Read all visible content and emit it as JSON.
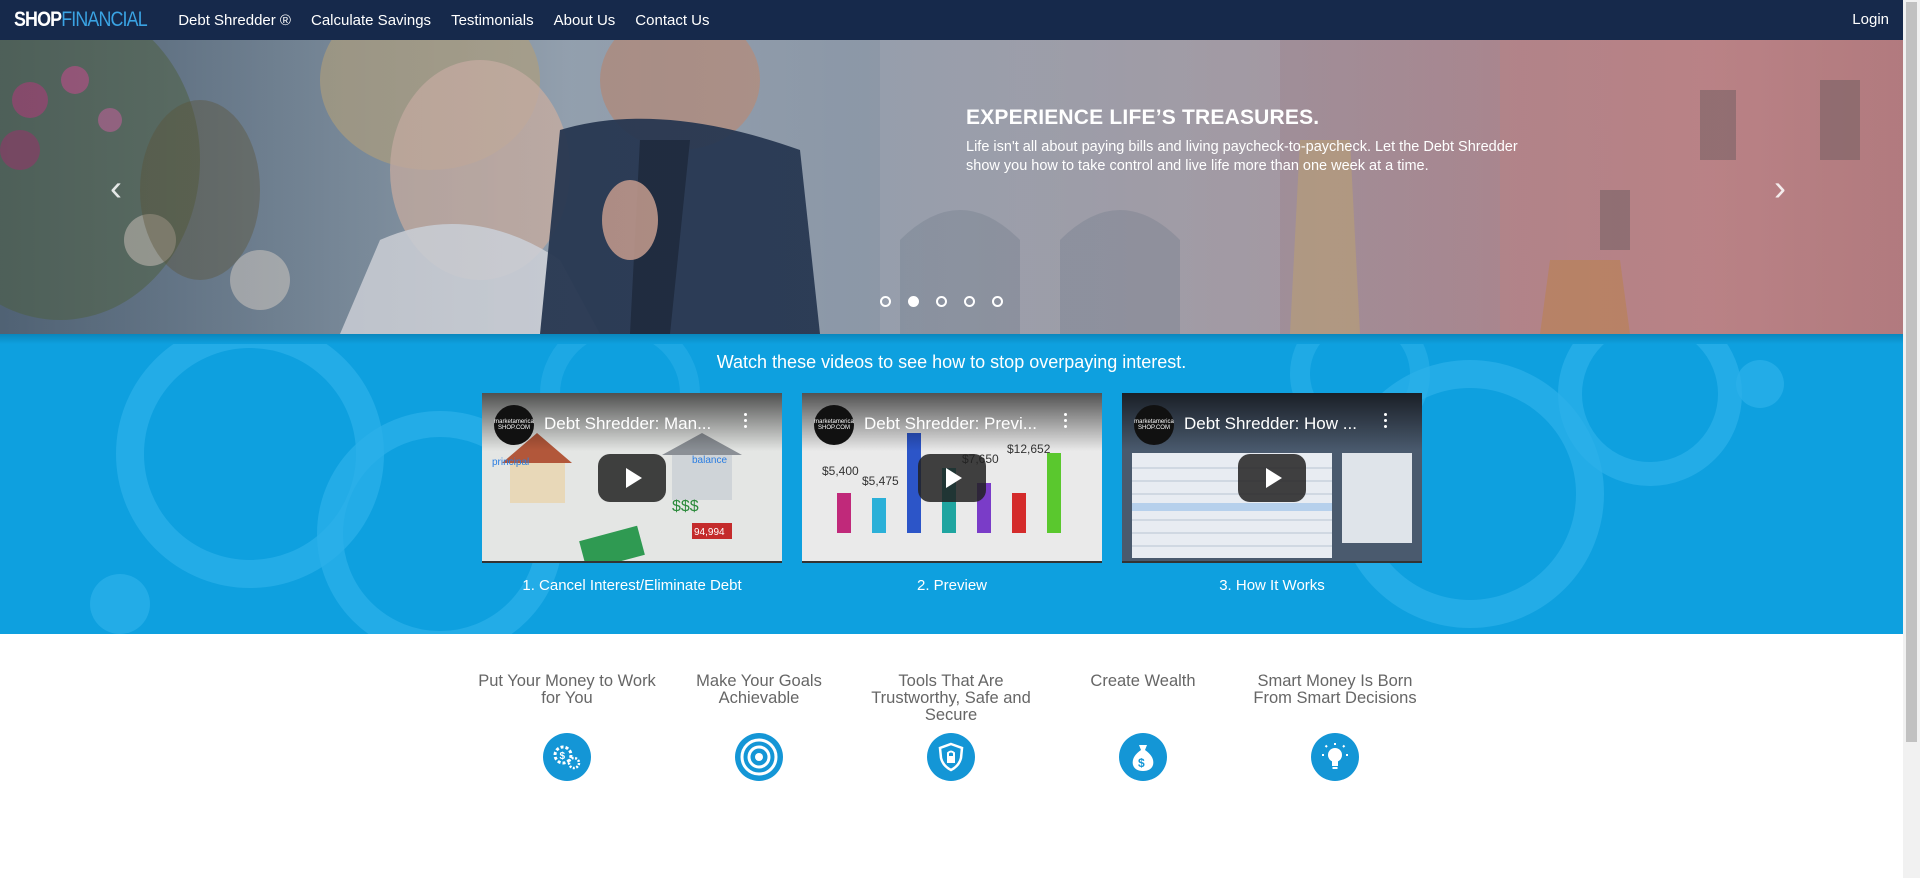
{
  "nav": {
    "logo_shop": "SHOP",
    "logo_financial": "FINANCIAL",
    "links": [
      "Debt Shredder ®",
      "Calculate Savings",
      "Testimonials",
      "About Us",
      "Contact Us"
    ],
    "login": "Login"
  },
  "hero": {
    "title": "EXPERIENCE LIFE’S TREASURES.",
    "text": "Life isn't all about paying bills and living paycheck-to-paycheck. Let the Debt Shredder show you how to take control and live life more than one week at a time.",
    "prev_icon": "‹",
    "next_icon": "›",
    "slide_count": 5,
    "active_slide": 2
  },
  "videos": {
    "heading": "Watch these videos to see how to stop overpaying interest.",
    "items": [
      {
        "title": "Debt Shredder: Man...",
        "label": "1. Cancel Interest/Eliminate Debt",
        "channel": "marketamerica SHOP.COM"
      },
      {
        "title": "Debt Shredder: Previ...",
        "label": "2. Preview",
        "channel": "marketamerica SHOP.COM"
      },
      {
        "title": "Debt Shredder: How ...",
        "label": "3. How It Works",
        "channel": "marketamerica SHOP.COM"
      }
    ]
  },
  "features": [
    {
      "title": "Put Your Money to Work for You",
      "icon": "gears-dollar-icon"
    },
    {
      "title": "Make Your Goals Achievable",
      "icon": "target-icon"
    },
    {
      "title": "Tools That Are Trustworthy, Safe and Secure",
      "icon": "shield-lock-icon"
    },
    {
      "title": "Create Wealth",
      "icon": "money-bag-icon"
    },
    {
      "title": "Smart Money Is Born From Smart Decisions",
      "icon": "lightbulb-icon"
    }
  ],
  "colors": {
    "navbar": "#16294b",
    "accent_blue": "#0ea0df",
    "icon_blue": "#1496d6",
    "logo_blue": "#3aa3e3"
  }
}
